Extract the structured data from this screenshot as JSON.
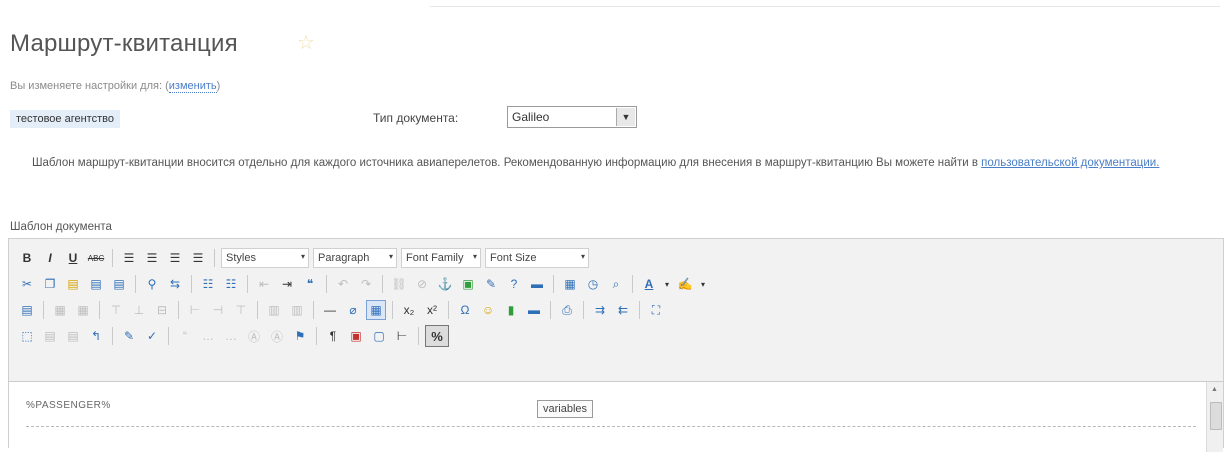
{
  "page": {
    "title": "Маршрут-квитанция",
    "settings_note_prefix": "Вы изменяете настройки для:",
    "settings_note_paren_open": "(",
    "settings_change_link": "изменить",
    "settings_note_paren_close": ")",
    "agency": "тестовое агентство",
    "doc_type_label": "Тип документа:",
    "doc_type_value": "Galileo",
    "info_text": "Шаблон маршрут-квитанции вносится отдельно для каждого источника авиаперелетов. Рекомендованную информацию для внесения в маршрут-квитанцию Вы можете найти в",
    "info_link": "пользовательской документации.",
    "template_label": "Шаблон документа"
  },
  "toolbar": {
    "bold": "B",
    "italic": "I",
    "underline": "U",
    "strike": "ABC",
    "styles": "Styles",
    "paragraph": "Paragraph",
    "font_family": "Font Family",
    "font_size": "Font Size",
    "caret": "▾",
    "subscript": "x₂",
    "superscript": "x²",
    "omega": "Ω",
    "variables_symbol": "%",
    "variables_tooltip": "variables",
    "font_color_a": "A",
    "pilcrow": "¶"
  },
  "editor": {
    "content": "%PASSENGER%"
  },
  "icons": {
    "star": "star-icon",
    "select_arrow": "chevron-down-icon"
  },
  "colors": {
    "link": "#4a7ec6",
    "agency_bg": "#e3eef8",
    "toolbar_bg": "#f2f2f2"
  }
}
